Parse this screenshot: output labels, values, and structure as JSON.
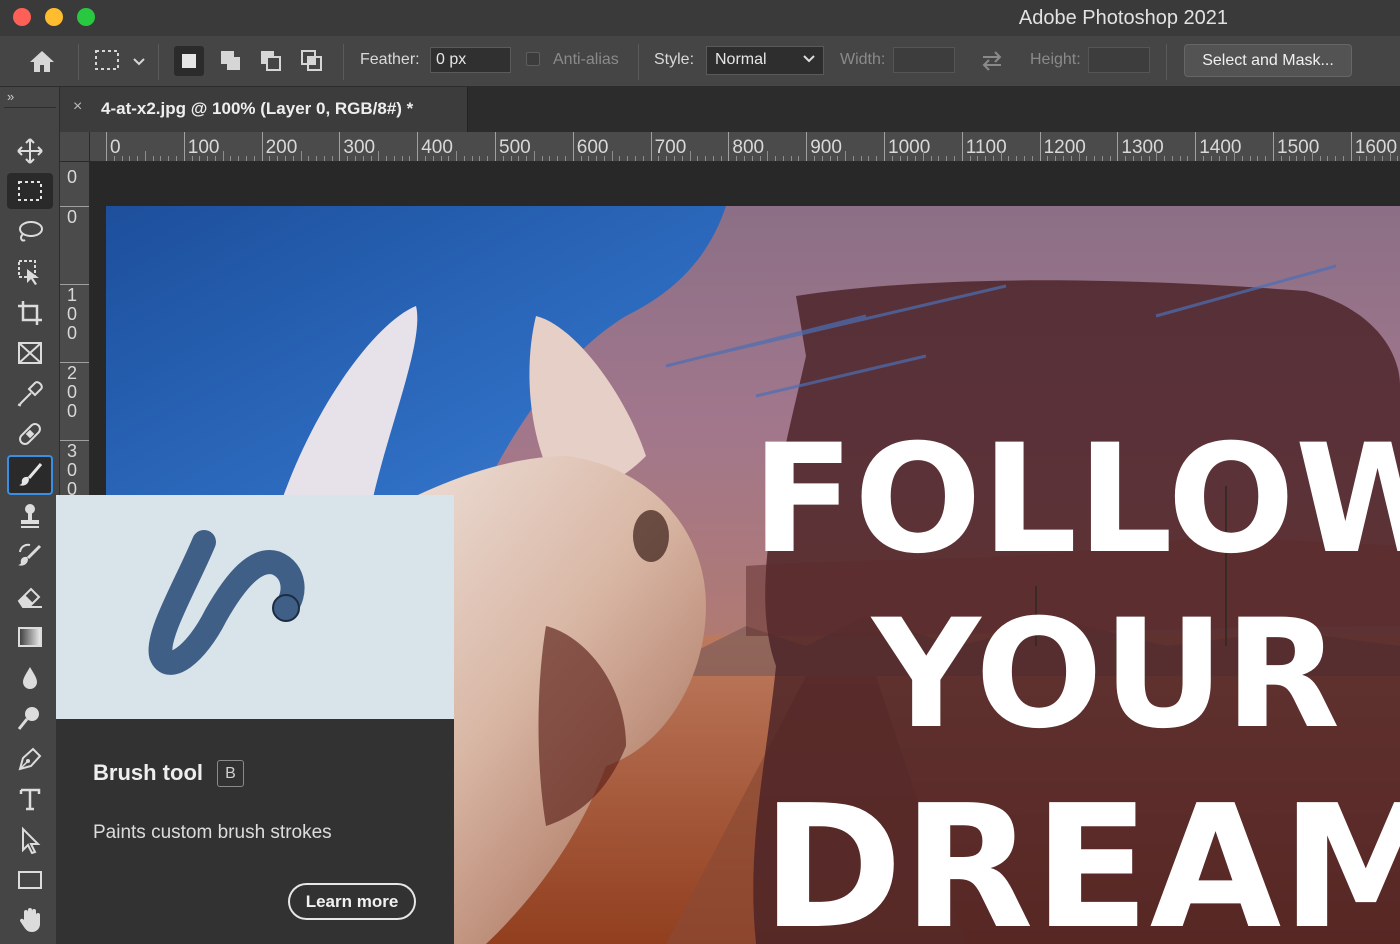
{
  "window": {
    "title": "Adobe Photoshop 2021"
  },
  "options_bar": {
    "feather_label": "Feather:",
    "feather_value": "0 px",
    "anti_alias_label": "Anti-alias",
    "style_label": "Style:",
    "style_value": "Normal",
    "width_label": "Width:",
    "height_label": "Height:",
    "select_and_mask_label": "Select and Mask..."
  },
  "document_tab": {
    "title": "4-at-x2.jpg @ 100% (Layer 0, RGB/8#) *",
    "close_glyph": "×"
  },
  "toolbar": {
    "collapse_glyph": "»"
  },
  "rulers": {
    "horizontal_labels": [
      "0",
      "100",
      "200",
      "300",
      "400",
      "500",
      "600",
      "700",
      "800",
      "900",
      "1000",
      "1100",
      "1200",
      "1300",
      "1400",
      "1500",
      "1600"
    ],
    "vertical_labels": [
      "0",
      "100",
      "200",
      "300"
    ]
  },
  "artwork": {
    "lines": [
      "FOLLOW",
      "YOUR",
      "DREAM"
    ]
  },
  "tooltip": {
    "title": "Brush tool",
    "shortcut": "B",
    "description": "Paints custom brush strokes",
    "learn_more_label": "Learn more"
  },
  "colors": {
    "accent": "#3a8ee6",
    "panel": "#454545",
    "canvas_bg": "#282828",
    "tooltip_preview": "#d9e3ea",
    "stroke_blue": "#3f5f87"
  }
}
